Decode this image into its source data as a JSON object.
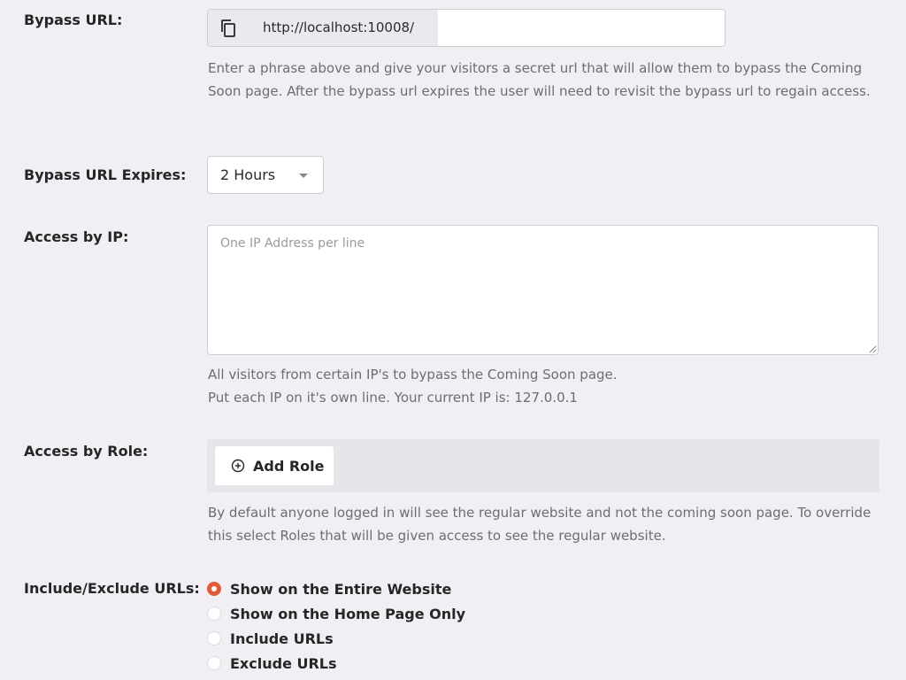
{
  "bypass_url": {
    "label": "Bypass URL:",
    "base": "http://localhost:10008/",
    "value": "",
    "help": "Enter a phrase above and give your visitors a secret url that will allow them to bypass the Coming Soon page. After the bypass url expires the user will need to revisit the bypass url to regain access."
  },
  "bypass_expires": {
    "label": "Bypass URL Expires:",
    "selected": "2 Hours"
  },
  "access_ip": {
    "label": "Access by IP:",
    "placeholder": "One IP Address per line",
    "help_line1": "All visitors from certain IP's to bypass the Coming Soon page.",
    "help_line2": "Put each IP on it's own line. Your current IP is: 127.0.0.1"
  },
  "access_role": {
    "label": "Access by Role:",
    "add_button": "Add Role",
    "help": "By default anyone logged in will see the regular website and not the coming soon page. To override this select Roles that will be given access to see the regular website."
  },
  "include_exclude": {
    "label": "Include/Exclude URLs:",
    "options": [
      {
        "label": "Show on the Entire Website",
        "checked": true
      },
      {
        "label": "Show on the Home Page Only",
        "checked": false
      },
      {
        "label": "Include URLs",
        "checked": false
      },
      {
        "label": "Exclude URLs",
        "checked": false
      }
    ]
  },
  "colors": {
    "accent": "#e25a3a",
    "background": "#f1eff3"
  },
  "icons": {
    "copy": "copy-icon",
    "add": "plus-circle-icon",
    "dropdown": "chevron-down-icon"
  }
}
